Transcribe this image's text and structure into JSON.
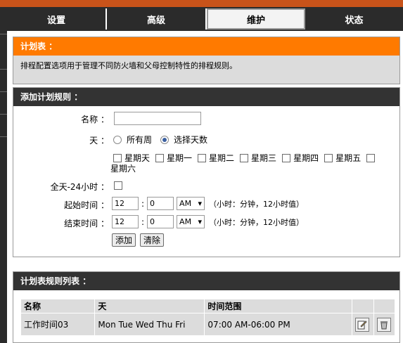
{
  "tabs": [
    "设置",
    "高级",
    "维护",
    "状态"
  ],
  "intro": {
    "title": "计划表 ：",
    "text": "排程配置选项用于管理不同防火墙和父母控制特性的排程规则。"
  },
  "form": {
    "title": "添加计划规则 ：",
    "name_label": "名称 ：",
    "name_value": "",
    "day_label": "天 ：",
    "radio_all_week": "所有周",
    "radio_select_days": "选择天数",
    "days": [
      "星期天",
      "星期一",
      "星期二",
      "星期三",
      "星期四",
      "星期五",
      "星期六"
    ],
    "allday_label": "全天-24小时 ：",
    "start_label": "起始时间 ：",
    "start_hour": "12",
    "start_min": "0",
    "start_ampm": "AM",
    "end_label": "结束时间 ：",
    "end_hour": "12",
    "end_min": "0",
    "end_ampm": "AM",
    "time_hint": "（小时：分钟，12小时值）",
    "colon": ":",
    "add_button": "添加",
    "clear_button": "清除"
  },
  "list": {
    "title": "计划表规则列表 ：",
    "headers": [
      "名称",
      "天",
      "时间范围"
    ],
    "rows": [
      {
        "name": "工作时间03",
        "days": "Mon Tue Wed Thu Fri",
        "range": "07:00 AM-06:00 PM"
      }
    ]
  },
  "colors": {
    "accent_orange": "#ff7a00",
    "top_bar": "#c8531a",
    "dark": "#2b2b2b"
  }
}
